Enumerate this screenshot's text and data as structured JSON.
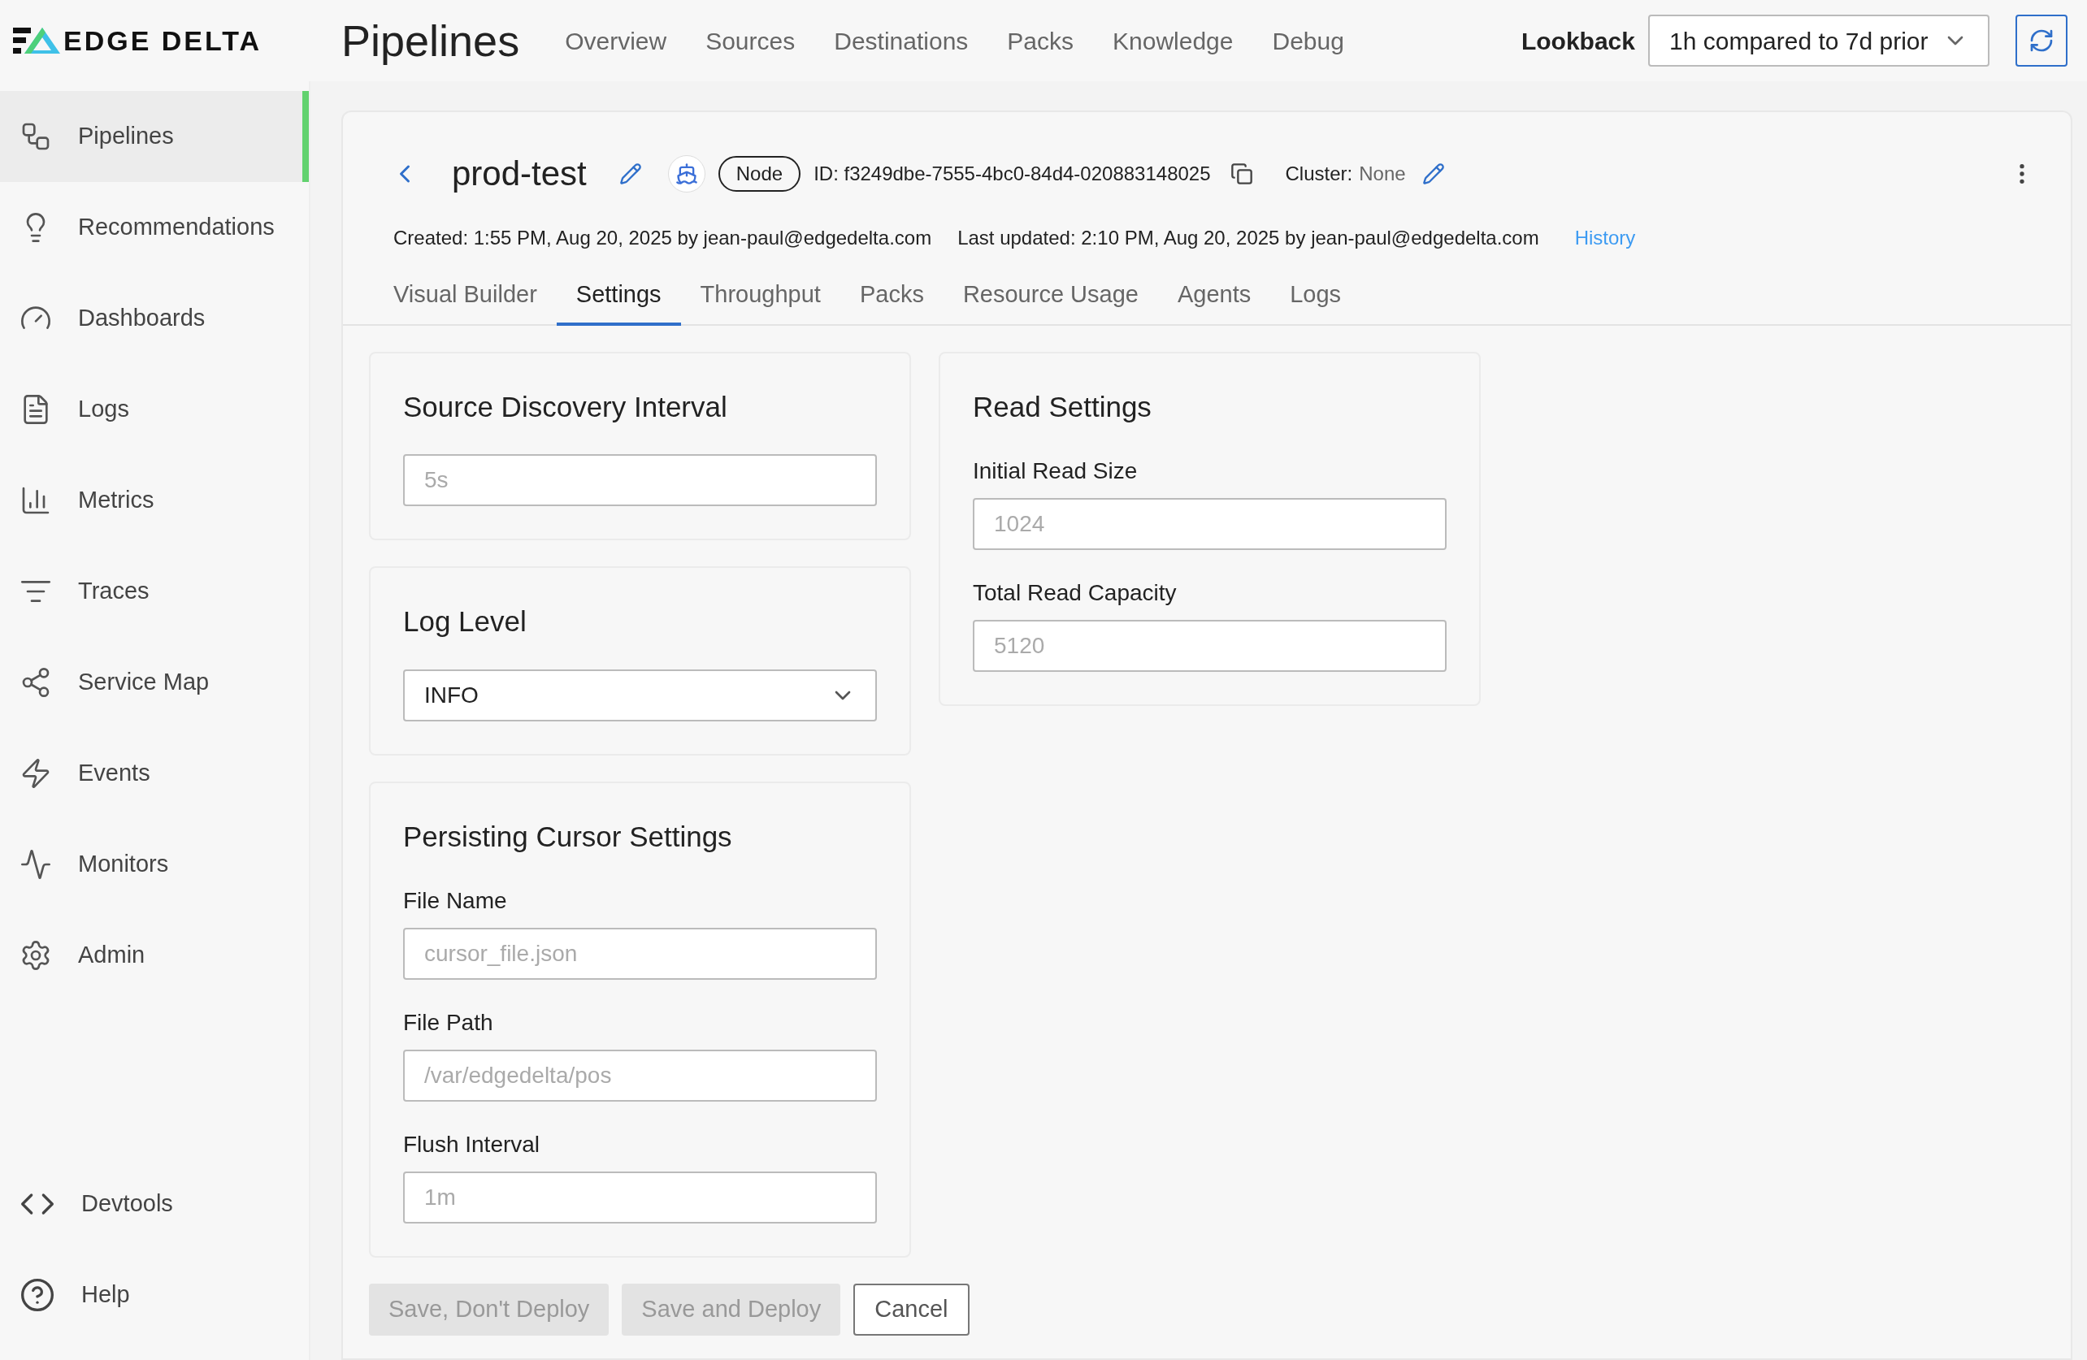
{
  "logo": {
    "text": "EDGE DELTA"
  },
  "header": {
    "title": "Pipelines",
    "nav": [
      {
        "label": "Overview"
      },
      {
        "label": "Sources"
      },
      {
        "label": "Destinations"
      },
      {
        "label": "Packs"
      },
      {
        "label": "Knowledge"
      },
      {
        "label": "Debug"
      }
    ],
    "lookback_label": "Lookback",
    "lookback_value": "1h compared to 7d prior"
  },
  "sidebar": {
    "items": [
      {
        "label": "Pipelines",
        "selected": true
      },
      {
        "label": "Recommendations",
        "selected": false
      },
      {
        "label": "Dashboards",
        "selected": false
      },
      {
        "label": "Logs",
        "selected": false
      },
      {
        "label": "Metrics",
        "selected": false
      },
      {
        "label": "Traces",
        "selected": false
      },
      {
        "label": "Service Map",
        "selected": false
      },
      {
        "label": "Events",
        "selected": false
      },
      {
        "label": "Monitors",
        "selected": false
      },
      {
        "label": "Admin",
        "selected": false
      }
    ],
    "bottom_items": [
      {
        "label": "Devtools"
      },
      {
        "label": "Help"
      }
    ]
  },
  "pipeline": {
    "name": "prod-test",
    "type_badge": "Node",
    "id": "ID: f3249dbe-7555-4bc0-84d4-020883148025",
    "cluster_label": "Cluster:",
    "cluster_value": "None",
    "created": "Created: 1:55 PM, Aug 20, 2025 by jean-paul@edgedelta.com",
    "updated": "Last updated: 2:10 PM, Aug 20, 2025 by jean-paul@edgedelta.com",
    "history_link": "History"
  },
  "tabs": [
    {
      "label": "Visual Builder",
      "selected": false
    },
    {
      "label": "Settings",
      "selected": true
    },
    {
      "label": "Throughput",
      "selected": false
    },
    {
      "label": "Packs",
      "selected": false
    },
    {
      "label": "Resource Usage",
      "selected": false
    },
    {
      "label": "Agents",
      "selected": false
    },
    {
      "label": "Logs",
      "selected": false
    }
  ],
  "left_cards": [
    {
      "title": "Source Discovery Interval",
      "fields": [
        {
          "kind": "input",
          "placeholder": "5s"
        }
      ]
    },
    {
      "title": "Log Level",
      "fields": [
        {
          "kind": "select",
          "value": "INFO"
        }
      ]
    },
    {
      "title": "Persisting Cursor Settings",
      "fields": [
        {
          "kind": "input",
          "label": "File Name",
          "placeholder": "cursor_file.json"
        },
        {
          "kind": "input",
          "label": "File Path",
          "placeholder": "/var/edgedelta/pos"
        },
        {
          "kind": "input",
          "label": "Flush Interval",
          "placeholder": "1m"
        }
      ]
    }
  ],
  "right_cards": [
    {
      "title": "Read Settings",
      "fields": [
        {
          "kind": "input",
          "label": "Initial Read Size",
          "placeholder": "1024"
        },
        {
          "kind": "input",
          "label": "Total Read Capacity",
          "placeholder": "5120"
        }
      ]
    }
  ],
  "buttons": [
    {
      "label": "Save, Don't Deploy",
      "disabled": true
    },
    {
      "label": "Save and Deploy",
      "disabled": true
    },
    {
      "label": "Cancel",
      "disabled": false
    }
  ]
}
